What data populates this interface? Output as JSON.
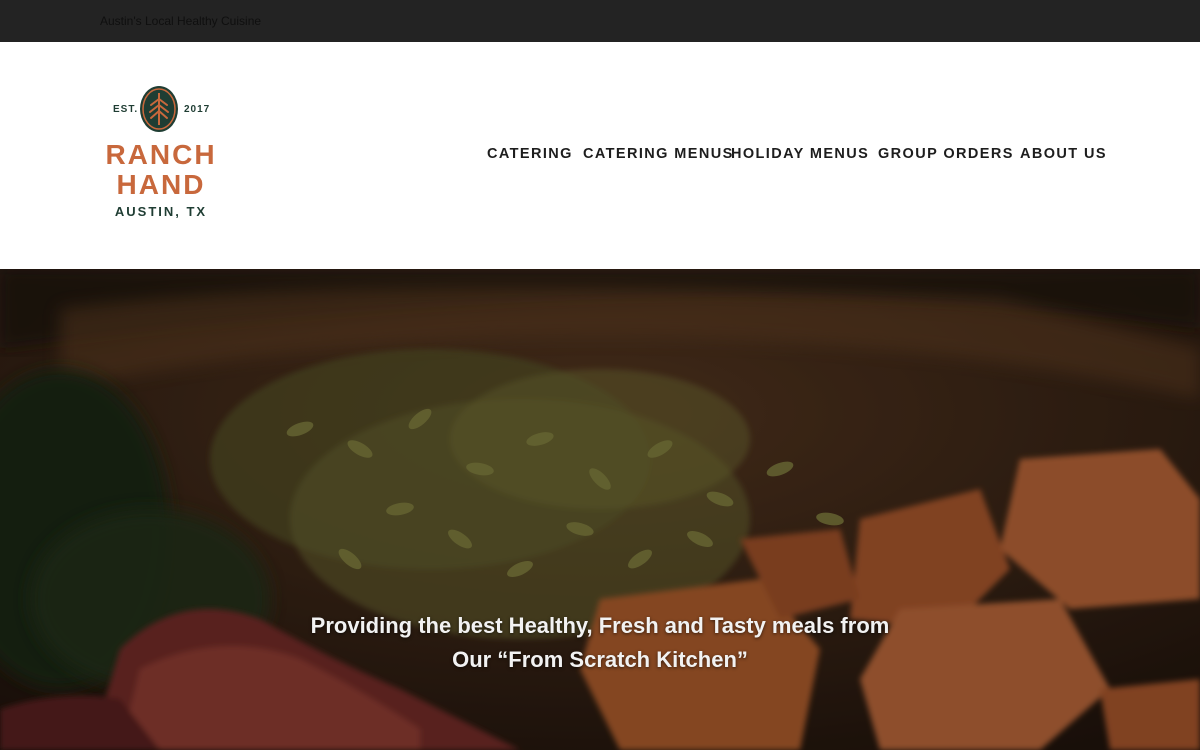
{
  "topbar": {
    "tagline": "Austin's Local Healthy Cuisine"
  },
  "logo": {
    "est": "EST.",
    "year": "2017",
    "line1": "RANCH",
    "line2": "HAND",
    "city": "AUSTIN, TX",
    "brand_orange": "#c8683c",
    "brand_green": "#1f3d33",
    "icon": "wheat-emblem-icon"
  },
  "nav": {
    "items": [
      {
        "label": "CATERING"
      },
      {
        "label": "CATERING MENUS"
      },
      {
        "label": "HOLIDAY MENUS"
      },
      {
        "label": "GROUP ORDERS"
      },
      {
        "label": "ABOUT US"
      }
    ]
  },
  "hero": {
    "line1": "Providing the best Healthy, Fresh and Tasty meals from",
    "line2": "Our “From Scratch Kitchen”"
  }
}
